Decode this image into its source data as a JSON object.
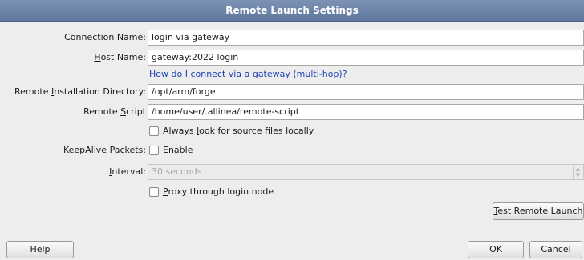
{
  "window": {
    "title": "Remote Launch Settings"
  },
  "form": {
    "connection_name": {
      "label": "Connection Name:",
      "value": "login via gateway"
    },
    "host_name": {
      "label_prefix": "",
      "label_mnemonic": "H",
      "label_rest": "ost Name:",
      "value": "gateway:2022 login"
    },
    "help_link": "How do I connect via a gateway (multi-hop)?",
    "remote_install_dir": {
      "label_prefix": "Remote ",
      "label_mnemonic": "I",
      "label_rest": "nstallation Directory:",
      "value": "/opt/arm/forge"
    },
    "remote_script": {
      "label_prefix": "Remote ",
      "label_mnemonic": "S",
      "label_rest": "cript",
      "value": "/home/user/.allinea/remote-script"
    },
    "always_look_local": {
      "prefix": "Always ",
      "mnemonic": "l",
      "rest": "ook for source files locally",
      "checked": false
    },
    "keepalive": {
      "label": "KeepAlive Packets:",
      "option_prefix": "",
      "option_mnemonic": "E",
      "option_rest": "nable",
      "checked": false
    },
    "interval": {
      "label_prefix": "",
      "label_mnemonic": "I",
      "label_rest": "nterval:",
      "value": "30 seconds",
      "enabled": false
    },
    "proxy": {
      "prefix": "",
      "mnemonic": "P",
      "rest": "roxy through login node",
      "checked": false
    }
  },
  "buttons": {
    "test_prefix": "",
    "test_mnemonic": "T",
    "test_rest": "est Remote Launch",
    "help": "Help",
    "ok": "OK",
    "cancel": "Cancel"
  }
}
